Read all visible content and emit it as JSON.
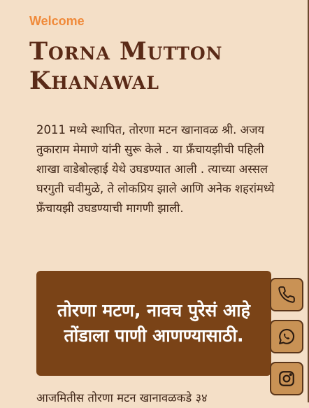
{
  "hero": {
    "welcome": "Welcome",
    "title": "Torna Mutton Khanawal"
  },
  "about": {
    "intro": "2011 मध्ये स्थापित, तोरणा मटन खानावळ श्री. अजय तुकाराम मेमाणे यांनी सुरू केले . या फ्रँचायझीची पहिली शाखा वाडेबोल्हाई येथे उघडण्यात आली . त्याच्या अस्सल घरगुती चवीमुळे, ते लोकप्रिय झाले आणि अनेक शहरांमध्ये फ्रँचायझी उघडण्याची मागणी झाली.",
    "quote": "तोरणा मटण, नावच पुरेसं आहे तोंडाला पाणी आणण्यासाठी.",
    "more": "आजमितीस तोरणा मटन खानावळकडे ३४"
  },
  "contact_buttons": [
    {
      "icon": "phone-icon"
    },
    {
      "icon": "whatsapp-icon"
    },
    {
      "icon": "instagram-icon"
    }
  ],
  "colors": {
    "background": "#f4dfc7",
    "accent": "#f08a3a",
    "title": "#5a2a17",
    "card": "#7a4317",
    "button": "#c99255"
  }
}
